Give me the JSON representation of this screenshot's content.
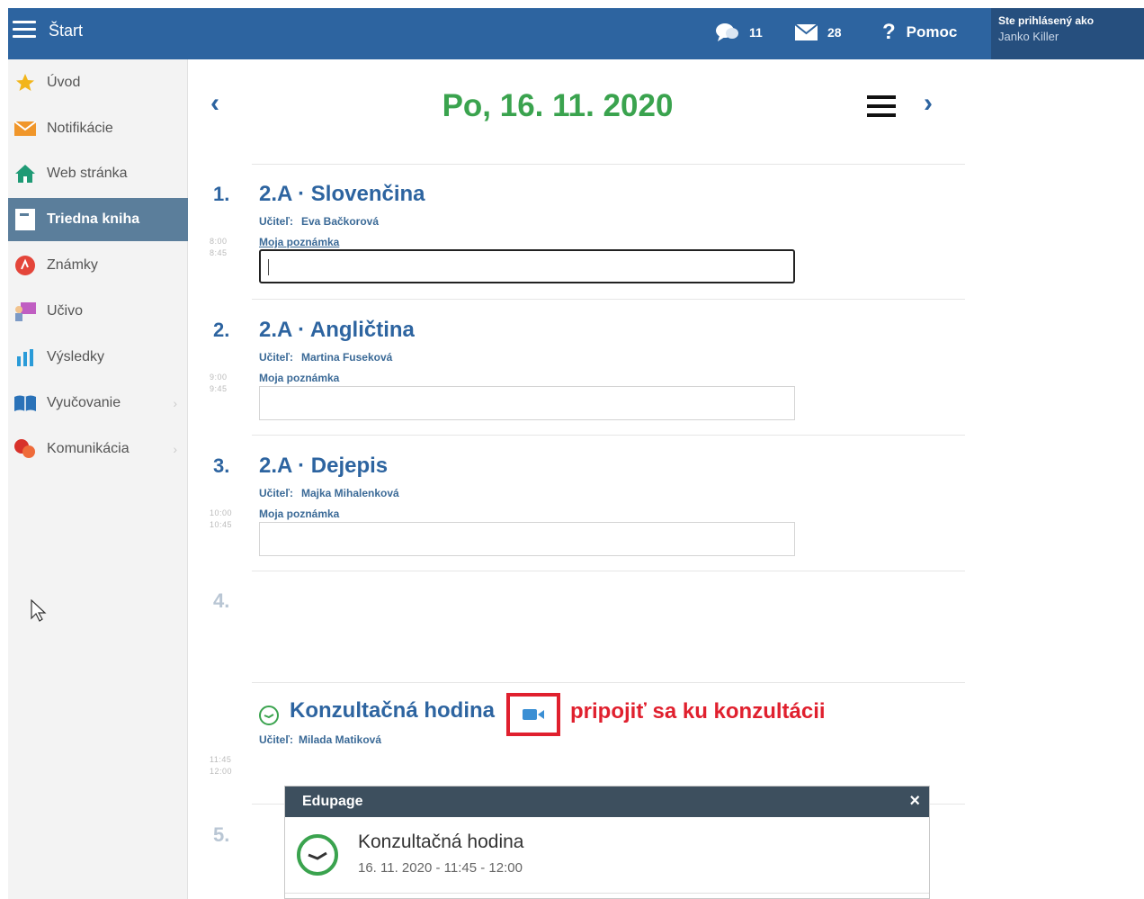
{
  "topbar": {
    "start_label": "Štart",
    "chat_count": "11",
    "mail_count": "28",
    "help_label": "Pomoc",
    "user_line1": "Ste prihlásený ako",
    "user_line2": "Janko Killer"
  },
  "sidebar": {
    "items": [
      {
        "label": "Úvod"
      },
      {
        "label": "Notifikácie"
      },
      {
        "label": "Web stránka"
      },
      {
        "label": "Triedna kniha"
      },
      {
        "label": "Známky"
      },
      {
        "label": "Učivo"
      },
      {
        "label": "Výsledky"
      },
      {
        "label": "Vyučovanie"
      },
      {
        "label": "Komunikácia"
      }
    ]
  },
  "main": {
    "date": "Po, 16. 11. 2020",
    "teacher_label": "Učiteľ:",
    "note_label": "Moja poznámka",
    "lessons": [
      {
        "num": "1.",
        "time_start": "8:00",
        "time_end": "8:45",
        "title": "2.A · Slovenčina",
        "teacher": "Eva Bačkorová"
      },
      {
        "num": "2.",
        "time_start": "9:00",
        "time_end": "9:45",
        "title": "2.A · Angličtina",
        "teacher": "Martina Fuseková"
      },
      {
        "num": "3.",
        "time_start": "10:00",
        "time_end": "10:45",
        "title": "2.A · Dejepis",
        "teacher": "Majka Mihalenková"
      }
    ],
    "empty_lesson_num": "4.",
    "consultation": {
      "title": "Konzultačná hodina",
      "teacher": "Milada Matiková",
      "time_start": "11:45",
      "time_end": "12:00",
      "join_text": "pripojiť sa ku konzultácii"
    },
    "next_lesson_num": "5."
  },
  "popup": {
    "header": "Edupage",
    "close": "×",
    "title": "Konzultačná hodina",
    "subtitle": "16. 11. 2020 - 11:45 - 12:00"
  },
  "colors": {
    "topbar": "#2d64a0",
    "date_green": "#3aa34e",
    "accent_blue": "#2d64a0",
    "annotation_red": "#e0202e",
    "sidebar_active": "#5b7e9b"
  }
}
